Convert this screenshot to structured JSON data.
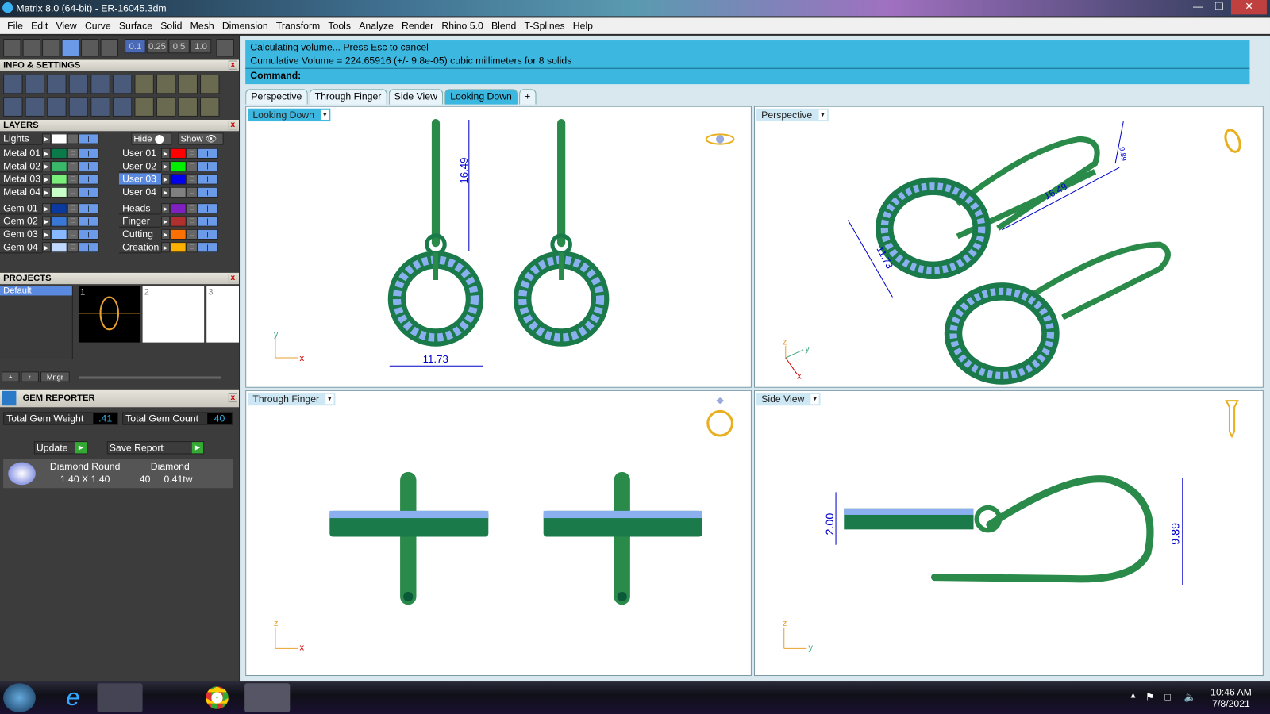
{
  "window": {
    "title": "Matrix 8.0 (64-bit) - ER-16045.3dm"
  },
  "menu": [
    "File",
    "Edit",
    "View",
    "Curve",
    "Surface",
    "Solid",
    "Mesh",
    "Dimension",
    "Transform",
    "Tools",
    "Analyze",
    "Render",
    "Rhino 5.0",
    "Blend",
    "T-Splines",
    "Help"
  ],
  "snap_values": [
    "0.1",
    "0.25",
    "0.5",
    "1.0"
  ],
  "panels": {
    "info": "INFO & SETTINGS",
    "layers": "LAYERS",
    "projects": "PROJECTS",
    "gem": "GEM REPORTER"
  },
  "layers": {
    "lights": "Lights",
    "hide": "Hide",
    "show": "Show",
    "left": [
      {
        "name": "Metal 01",
        "color": "#0a7a4a"
      },
      {
        "name": "Metal 02",
        "color": "#3ab86a"
      },
      {
        "name": "Metal 03",
        "color": "#7aee7a"
      },
      {
        "name": "Metal 04",
        "color": "#c8ffc8"
      },
      {
        "name": "Gem 01",
        "color": "#0a3aa0"
      },
      {
        "name": "Gem 02",
        "color": "#3a78d8"
      },
      {
        "name": "Gem 03",
        "color": "#88b8ff"
      },
      {
        "name": "Gem 04",
        "color": "#c0d8ff"
      }
    ],
    "right": [
      {
        "name": "User 01",
        "color": "#ff0000"
      },
      {
        "name": "User 02",
        "color": "#00ee00"
      },
      {
        "name": "User 03",
        "color": "#0000ee",
        "selected": true
      },
      {
        "name": "User 04",
        "color": "#808080"
      },
      {
        "name": "Heads",
        "color": "#8020c0"
      },
      {
        "name": "Finger",
        "color": "#b03030"
      },
      {
        "name": "Cutting",
        "color": "#ff7000"
      },
      {
        "name": "Creation",
        "color": "#ffb000"
      }
    ]
  },
  "projects": {
    "list": [
      "Default"
    ],
    "thumbs": [
      "1",
      "2",
      "3"
    ],
    "mngr": "Mngr"
  },
  "gem_reporter": {
    "weight_label": "Total Gem Weight",
    "weight": ".41",
    "count_label": "Total Gem Count",
    "count": "40",
    "update": "Update",
    "save": "Save Report",
    "row": {
      "shape": "Diamond Round",
      "material": "Diamond",
      "size": "1.40 X 1.40",
      "qty": "40",
      "tw": "0.41tw"
    }
  },
  "command": {
    "line1": "Calculating volume... Press Esc to cancel",
    "line2": "Cumulative Volume = 224.65916 (+/- 9.8e-05) cubic millimeters for 8 solids",
    "prompt": "Command:"
  },
  "tabs": [
    "Perspective",
    "Through Finger",
    "Side View",
    "Looking Down"
  ],
  "active_tab": "Looking Down",
  "viewports": {
    "top": {
      "label": "Looking Down",
      "dim_h": "16.49",
      "dim_w": "11.73",
      "ax1": "y",
      "ax2": "x"
    },
    "persp": {
      "label": "Perspective",
      "d1": "16.49",
      "d2": "11.73",
      "d3": "9.89",
      "ax1": "z",
      "ax2": "y",
      "ax3": "x"
    },
    "front": {
      "label": "Through Finger",
      "ax1": "z",
      "ax2": "x"
    },
    "side": {
      "label": "Side View",
      "d1": "2.00",
      "d2": "9.89",
      "ax1": "z",
      "ax2": "y"
    }
  },
  "taskbar": {
    "time": "10:46 AM",
    "date": "7/8/2021"
  }
}
